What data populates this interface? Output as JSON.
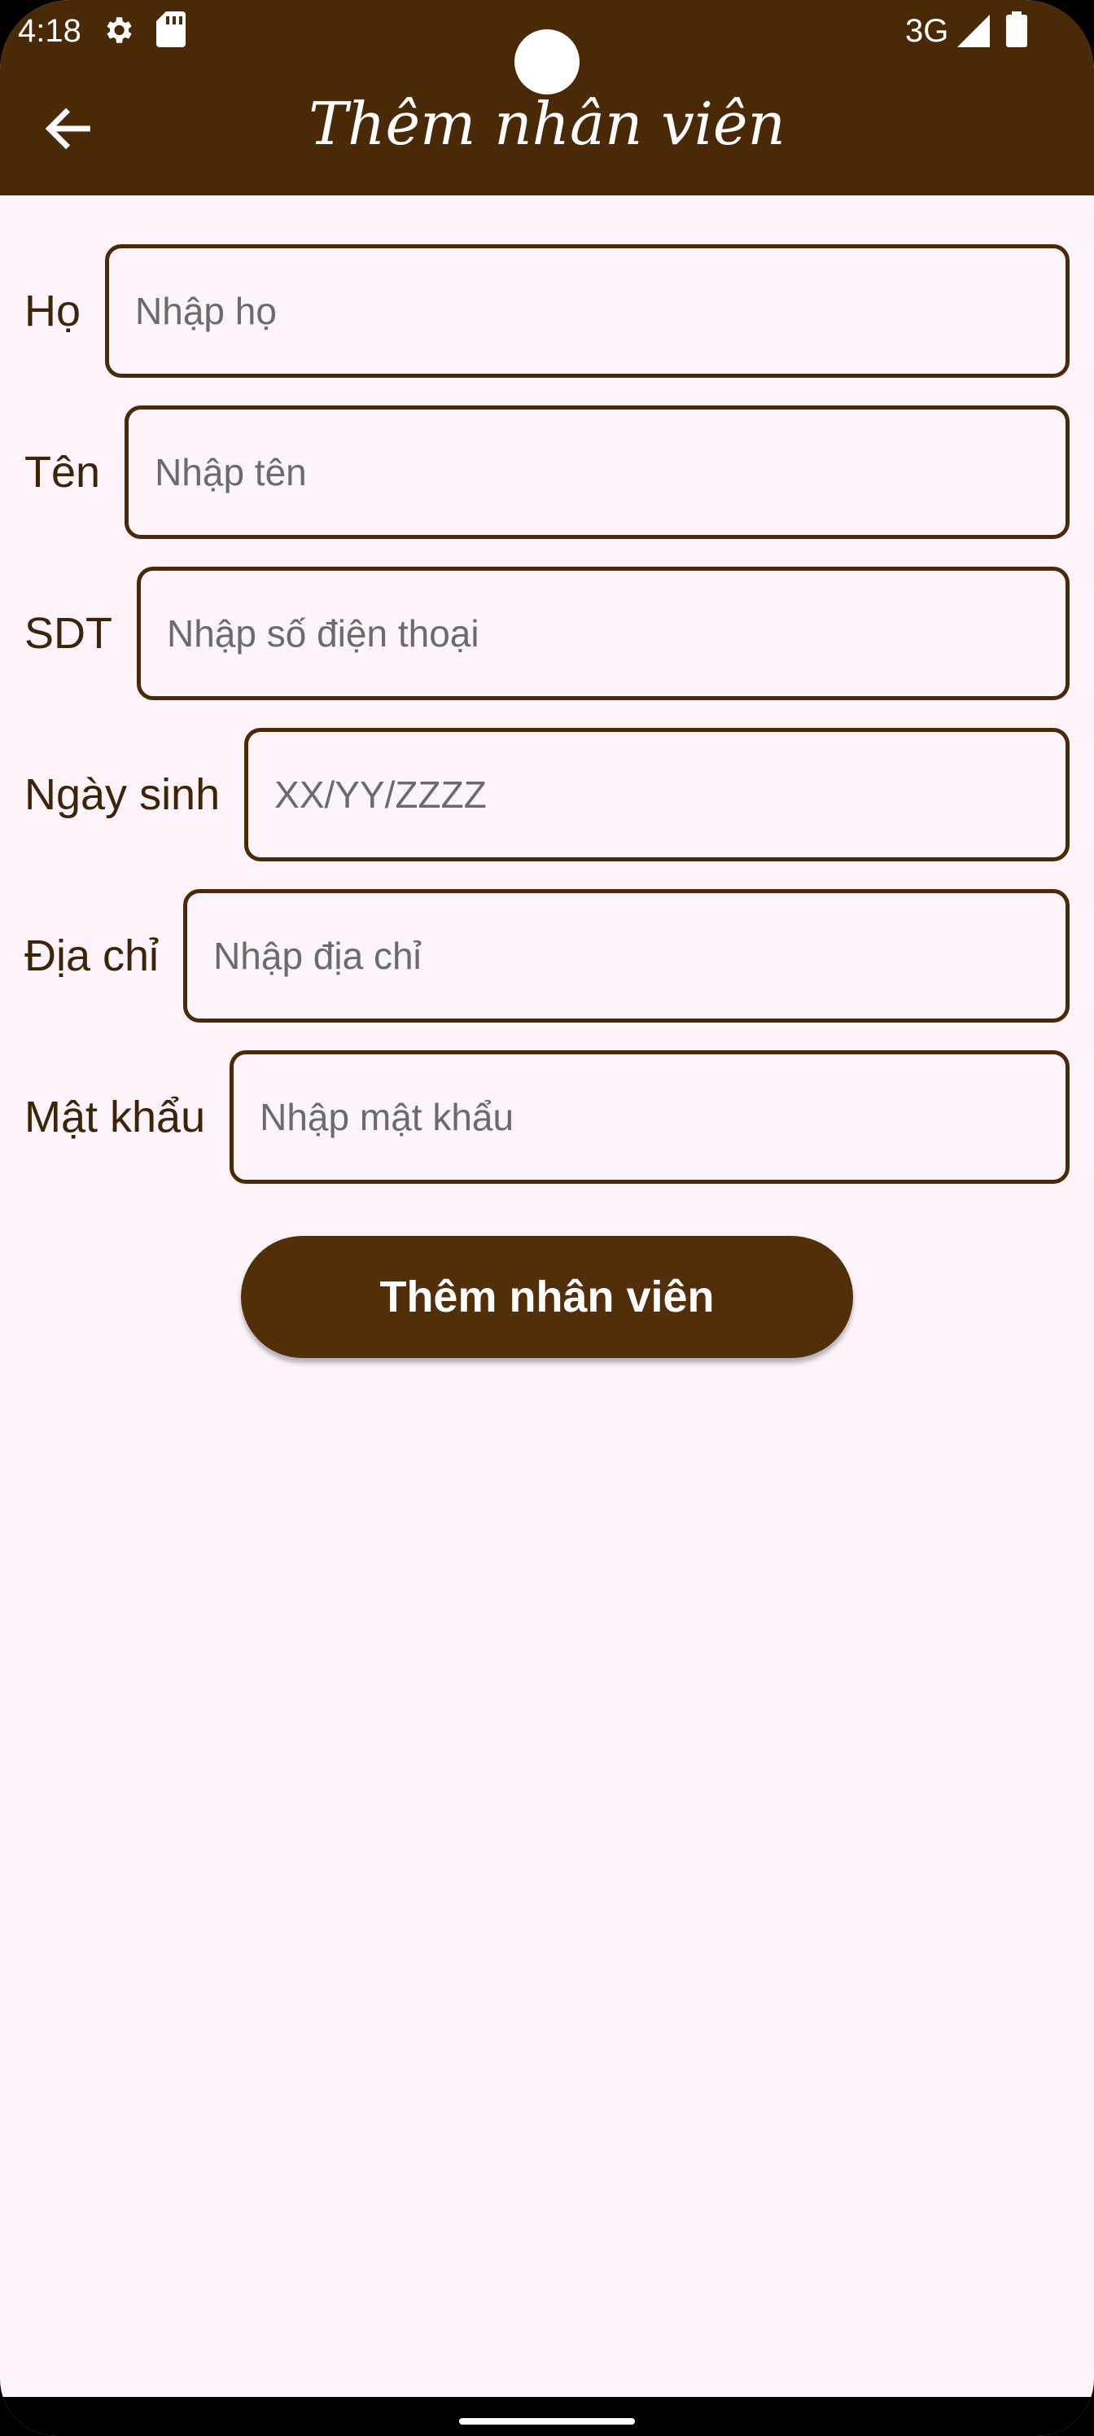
{
  "status_bar": {
    "time": "4:18",
    "network": "3G",
    "icons": [
      "gear-icon",
      "sd-card-icon",
      "signal-icon",
      "battery-icon"
    ]
  },
  "app_bar": {
    "title": "Thêm nhân viên",
    "back_icon": "arrow-left-icon"
  },
  "form": {
    "fields": [
      {
        "label": "Họ",
        "placeholder": "Nhập họ",
        "value": ""
      },
      {
        "label": "Tên",
        "placeholder": "Nhập tên",
        "value": ""
      },
      {
        "label": "SDT",
        "placeholder": "Nhập số điện thoại",
        "value": ""
      },
      {
        "label": "Ngày sinh",
        "placeholder": "XX/YY/ZZZZ",
        "value": ""
      },
      {
        "label": "Địa chỉ",
        "placeholder": "Nhập địa chỉ",
        "value": ""
      },
      {
        "label": "Mật khẩu",
        "placeholder": "Nhập mật khẩu",
        "value": ""
      }
    ],
    "submit_label": "Thêm nhân viên"
  },
  "colors": {
    "app_bar": "#4a2906",
    "background": "#fcf3fb",
    "button": "#522e09",
    "label": "#3d2406"
  }
}
